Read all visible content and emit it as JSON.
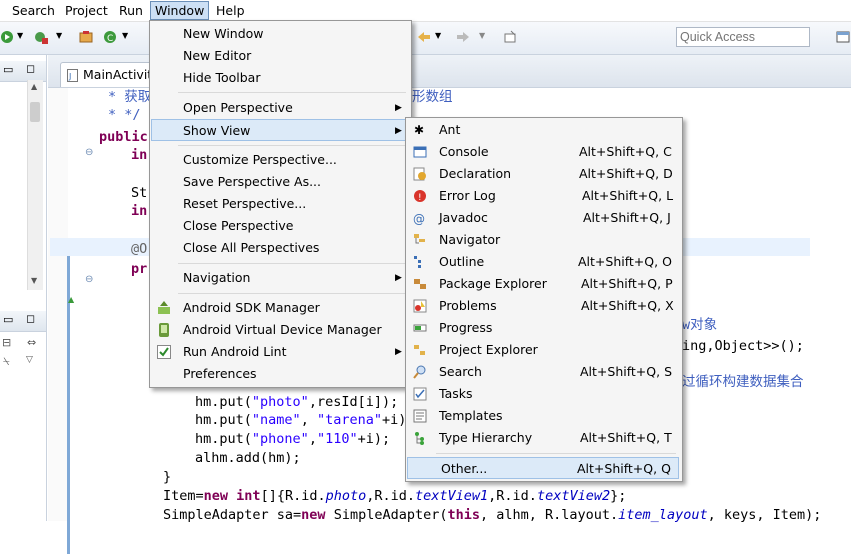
{
  "menubar": {
    "items": [
      "Search",
      "Project",
      "Run",
      "Window",
      "Help"
    ]
  },
  "quick_access": {
    "placeholder": "Quick Access"
  },
  "editor": {
    "tab_label": "MainActivity",
    "code": {
      "l1_comment": "* 获取",
      "l1_tail": "形数组",
      "l2_comment": "* */",
      "l3": "public",
      "l4": "in",
      "l5": "St",
      "l6": "in",
      "l7": "@O",
      "l8": "pr",
      "tail_a": "w对象",
      "tail_b": "ing,Object>>();",
      "tail_c": "过循环构建数据集合",
      "line_put_photo_pre": "hm.put(",
      "line_put_photo_key": "\"photo\"",
      "line_put_photo_post": ",resId[i]);",
      "line_put_name_pre": "hm.put(",
      "line_put_name_key": "\"name\"",
      "line_put_name_mid": ", ",
      "line_put_name_val": "\"tarena\"",
      "line_put_name_post": "+i)",
      "line_put_phone_pre": "hm.put(",
      "line_put_phone_key": "\"phone\"",
      "line_put_phone_mid": ",",
      "line_put_phone_val": "\"110\"",
      "line_put_phone_post": "+i);",
      "line_add": "alhm.add(hm);",
      "line_brace": "}",
      "line_item_a": "Item=",
      "line_item_new": "new",
      "line_item_int": "int",
      "line_item_b": "[]{R.id.",
      "line_item_photo": "photo",
      "line_item_c": ",R.id.",
      "line_item_tv1": "textView1",
      "line_item_d": ",R.id.",
      "line_item_tv2": "textView2",
      "line_item_e": "};",
      "line_sa_a": "SimpleAdapter sa=",
      "line_sa_new": "new",
      "line_sa_b": " SimpleAdapter(",
      "line_sa_this": "this",
      "line_sa_c": ", alhm, R.layout.",
      "line_sa_layout": "item_layout",
      "line_sa_d": ", keys, Item);"
    }
  },
  "window_menu": {
    "items": [
      {
        "label": "New Window"
      },
      {
        "label": "New Editor"
      },
      {
        "label": "Hide Toolbar"
      },
      {
        "label": "Open Perspective"
      },
      {
        "label": "Show View"
      },
      {
        "label": "Customize Perspective..."
      },
      {
        "label": "Save Perspective As..."
      },
      {
        "label": "Reset Perspective..."
      },
      {
        "label": "Close Perspective"
      },
      {
        "label": "Close All Perspectives"
      },
      {
        "label": "Navigation"
      },
      {
        "label": "Android SDK Manager"
      },
      {
        "label": "Android Virtual Device Manager"
      },
      {
        "label": "Run Android Lint"
      },
      {
        "label": "Preferences"
      }
    ]
  },
  "show_view_menu": {
    "items": [
      {
        "label": "Ant",
        "shortcut": ""
      },
      {
        "label": "Console",
        "shortcut": "Alt+Shift+Q, C"
      },
      {
        "label": "Declaration",
        "shortcut": "Alt+Shift+Q, D"
      },
      {
        "label": "Error Log",
        "shortcut": "Alt+Shift+Q, L"
      },
      {
        "label": "Javadoc",
        "shortcut": "Alt+Shift+Q, J"
      },
      {
        "label": "Navigator",
        "shortcut": ""
      },
      {
        "label": "Outline",
        "shortcut": "Alt+Shift+Q, O"
      },
      {
        "label": "Package Explorer",
        "shortcut": "Alt+Shift+Q, P"
      },
      {
        "label": "Problems",
        "shortcut": "Alt+Shift+Q, X"
      },
      {
        "label": "Progress",
        "shortcut": ""
      },
      {
        "label": "Project Explorer",
        "shortcut": ""
      },
      {
        "label": "Search",
        "shortcut": "Alt+Shift+Q, S"
      },
      {
        "label": "Tasks",
        "shortcut": ""
      },
      {
        "label": "Templates",
        "shortcut": ""
      },
      {
        "label": "Type Hierarchy",
        "shortcut": "Alt+Shift+Q, T"
      },
      {
        "label": "Other...",
        "shortcut": "Alt+Shift+Q, Q"
      }
    ]
  },
  "colors": {
    "accent": "#cde0f5",
    "hover": "#dceaf8",
    "keyword": "#7f0055",
    "string": "#2a00ff",
    "comment": "#3f5fbf"
  }
}
